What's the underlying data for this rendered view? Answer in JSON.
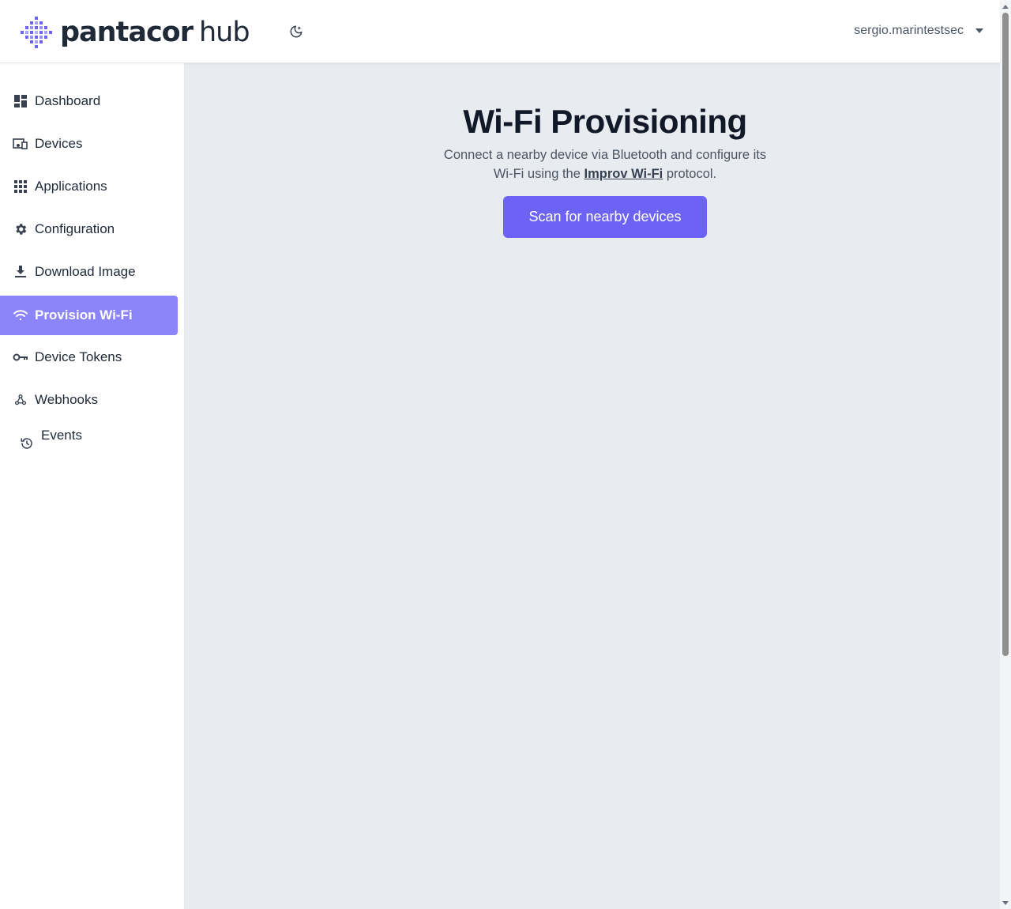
{
  "header": {
    "logo": {
      "brand": "pantacor",
      "product": "hub"
    },
    "theme_toggle_icon": "moon-icon",
    "user": {
      "name": "sergio.marintestsec",
      "caret_icon": "caret-down-icon"
    }
  },
  "sidebar": {
    "items": [
      {
        "label": "Dashboard",
        "icon": "dashboard-icon"
      },
      {
        "label": "Devices",
        "icon": "devices-icon"
      },
      {
        "label": "Applications",
        "icon": "apps-grid-icon"
      },
      {
        "label": "Configuration",
        "icon": "gear-icon"
      },
      {
        "label": "Download Image",
        "icon": "download-icon"
      },
      {
        "label": "Provision Wi-Fi",
        "icon": "wifi-icon",
        "active": true
      },
      {
        "label": "Device Tokens",
        "icon": "key-icon"
      },
      {
        "label": "Webhooks",
        "icon": "webhook-icon"
      },
      {
        "label": "Events",
        "icon": "history-icon"
      }
    ]
  },
  "main": {
    "title": "Wi-Fi Provisioning",
    "description_line1": "Connect a nearby device via Bluetooth and configure its",
    "description_line2_prefix": "Wi-Fi using the ",
    "description_link": "Improv Wi-Fi",
    "description_line2_suffix": " protocol.",
    "scan_button": "Scan for nearby devices"
  },
  "colors": {
    "accent": "#6c63f5",
    "active_nav": "#8b85f9",
    "main_bg": "#e8ebef",
    "logo_purple": "#6c63f5"
  }
}
